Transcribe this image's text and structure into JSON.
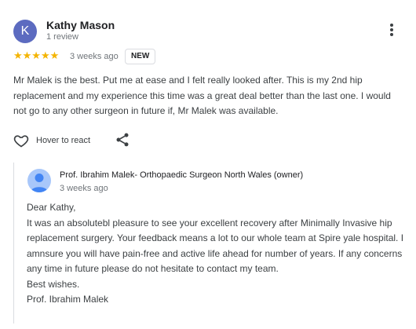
{
  "review": {
    "avatar_letter": "K",
    "avatar_color": "#5c6bc0",
    "name": "Kathy Mason",
    "review_count": "1 review",
    "rating": 5,
    "stars": "★★★★★",
    "star_color": "#f4b400",
    "time": "3 weeks ago",
    "badge": "NEW",
    "text": "Mr Malek is the best. Put me at ease and I felt really looked after. This is my 2nd hip replacement and my experience this time was a great deal better than the last one. I would not go to any other surgeon in future if, Mr Malek was available.",
    "menu_icon": "more-vert-icon",
    "react_icon": "heart-outline-icon",
    "react_label": "Hover to react",
    "share_icon": "share-icon"
  },
  "reply": {
    "owner_name": "Prof. Ibrahim Malek- Orthopaedic Surgeon North Wales (owner)",
    "owner_time": "3 weeks ago",
    "avatar_icon": "person-avatar-icon",
    "avatar_color": "#a8c7fa",
    "lines": [
      "Dear Kathy,",
      "It was an absolutebl pleasure to see your excellent recovery after Minimally Invasive hip replacement surgery. Your feedback means a lot to our whole team at Spire yale hospital. I amnsure you will have pain-free and active life ahead for number of years. If any concerns any time in future please do not hesitate to contact my team.",
      "Best wishes.",
      "Prof. Ibrahim Malek"
    ]
  }
}
